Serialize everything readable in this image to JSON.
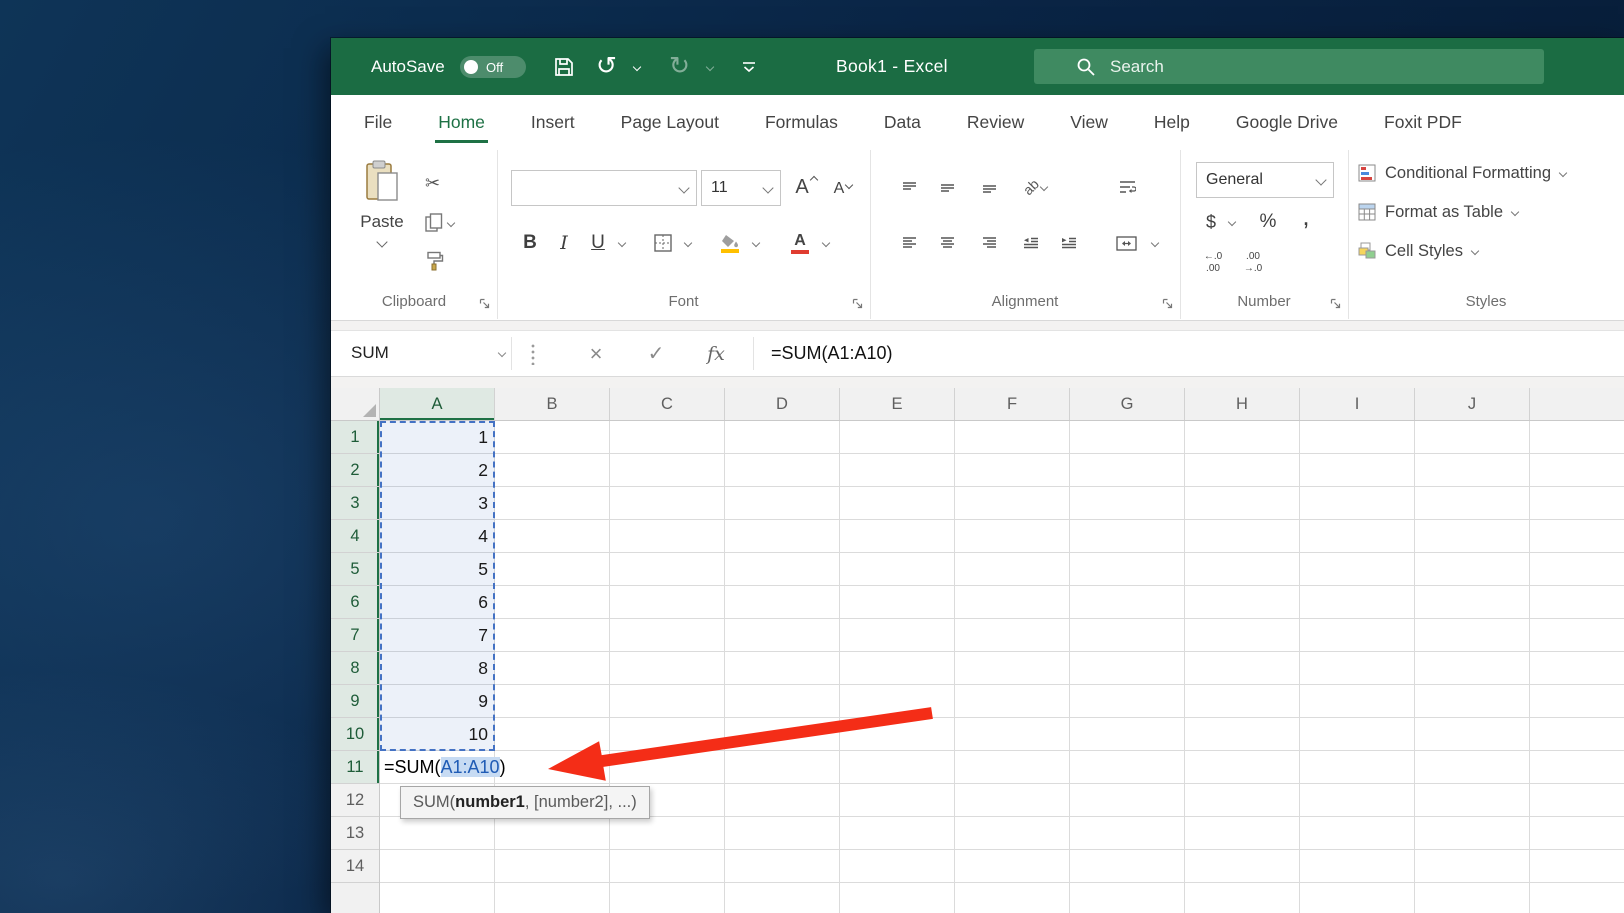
{
  "titlebar": {
    "autosave_label": "AutoSave",
    "autosave_state": "Off",
    "window_title": "Book1 - Excel",
    "search_placeholder": "Search"
  },
  "tabs": [
    {
      "label": "File",
      "active": false
    },
    {
      "label": "Home",
      "active": true
    },
    {
      "label": "Insert",
      "active": false
    },
    {
      "label": "Page Layout",
      "active": false
    },
    {
      "label": "Formulas",
      "active": false
    },
    {
      "label": "Data",
      "active": false
    },
    {
      "label": "Review",
      "active": false
    },
    {
      "label": "View",
      "active": false
    },
    {
      "label": "Help",
      "active": false
    },
    {
      "label": "Google Drive",
      "active": false
    },
    {
      "label": "Foxit PDF",
      "active": false
    }
  ],
  "ribbon": {
    "clipboard": {
      "group_label": "Clipboard",
      "paste_label": "Paste"
    },
    "font": {
      "group_label": "Font",
      "font_name": "",
      "font_size": "11",
      "bold": "B",
      "italic": "I",
      "underline": "U",
      "grow": "A",
      "shrink": "A"
    },
    "alignment": {
      "group_label": "Alignment",
      "orientation_icon_text": "ab"
    },
    "number": {
      "group_label": "Number",
      "format": "General",
      "currency": "$",
      "percent": "%",
      "comma": ",",
      "decrease_decimal": "←.0\n.00",
      "increase_decimal": ".00\n→.0"
    },
    "styles": {
      "group_label": "Styles",
      "conditional": "Conditional Formatting",
      "format_table": "Format as Table",
      "cell_styles": "Cell Styles"
    }
  },
  "formula_bar": {
    "name_box": "SUM",
    "fx": "fx",
    "formula": "=SUM(A1:A10)"
  },
  "grid": {
    "columns": [
      "A",
      "B",
      "C",
      "D",
      "E",
      "F",
      "G",
      "H",
      "I",
      "J"
    ],
    "selected_columns": [
      "A"
    ],
    "row_count": 14,
    "highlighted_rows_through": 11,
    "col_a_values": [
      "1",
      "2",
      "3",
      "4",
      "5",
      "6",
      "7",
      "8",
      "9",
      "10"
    ],
    "formula_cell": {
      "row": 11,
      "prefix": "=SUM(",
      "range": "A1:A10",
      "suffix": ")"
    },
    "tooltip": {
      "pre": "SUM(",
      "bold": "number1",
      "post": ", [number2], ...)"
    }
  },
  "icons": {
    "cut": "✂",
    "undo": "↺",
    "redo": "↻",
    "cancel": "×",
    "enter": "✓"
  },
  "colors": {
    "excel_green": "#1B6C43",
    "search_green": "#3F8A61",
    "accent_green": "#1E7145",
    "selection_blue": "#4472C4",
    "range_text_blue": "#1F5BB5",
    "range_bg": "#C7DBF3",
    "arrow_red": "#F42D17"
  }
}
